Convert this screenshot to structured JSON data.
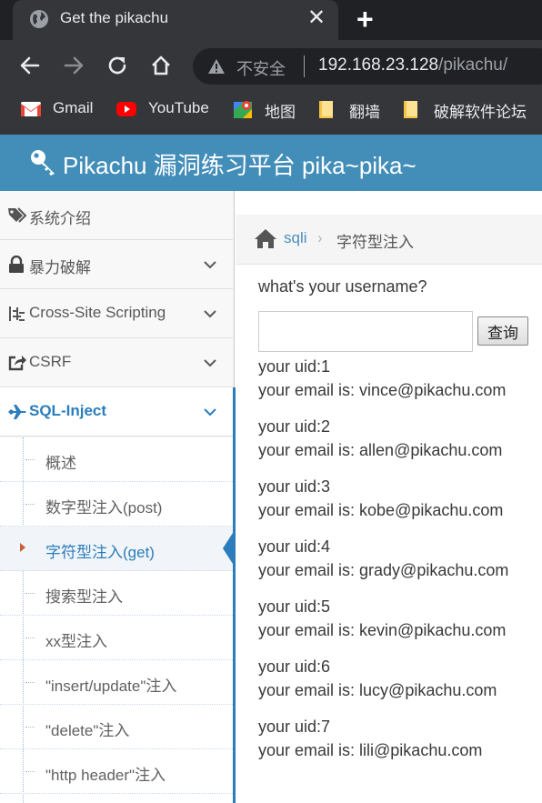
{
  "browser": {
    "tab_title": "Get the pikachu",
    "close_glyph": "✕",
    "newtab_glyph": "+",
    "insecure_label": "不安全",
    "url_host": "192.168.23.128",
    "url_path": "/pikachu/",
    "bookmarks": [
      {
        "label": "Gmail"
      },
      {
        "label": "YouTube"
      },
      {
        "label": "地图"
      },
      {
        "label": "翻墙"
      },
      {
        "label": "破解软件论坛"
      }
    ]
  },
  "header": {
    "title": "Pikachu 漏洞练习平台 pika~pika~"
  },
  "sidebar": {
    "items": [
      {
        "label": "系统介绍"
      },
      {
        "label": "暴力破解"
      },
      {
        "label": "Cross-Site Scripting"
      },
      {
        "label": "CSRF"
      },
      {
        "label": "SQL-Inject"
      }
    ],
    "sub_items": [
      {
        "label": "概述"
      },
      {
        "label": "数字型注入(post)"
      },
      {
        "label": "字符型注入(get)"
      },
      {
        "label": "搜索型注入"
      },
      {
        "label": "xx型注入"
      },
      {
        "label": "\"insert/update\"注入"
      },
      {
        "label": "\"delete\"注入"
      },
      {
        "label": "\"http header\"注入"
      }
    ]
  },
  "breadcrumb": {
    "parent": "sqli",
    "separator": "›",
    "current": "字符型注入"
  },
  "main": {
    "prompt": "what's your username?",
    "input_value": "",
    "submit_label": "查询",
    "results": [
      {
        "uid": "your uid:1",
        "email": "your email is: vince@pikachu.com"
      },
      {
        "uid": "your uid:2",
        "email": "your email is: allen@pikachu.com"
      },
      {
        "uid": "your uid:3",
        "email": "your email is: kobe@pikachu.com"
      },
      {
        "uid": "your uid:4",
        "email": "your email is: grady@pikachu.com"
      },
      {
        "uid": "your uid:5",
        "email": "your email is: kevin@pikachu.com"
      },
      {
        "uid": "your uid:6",
        "email": "your email is: lucy@pikachu.com"
      },
      {
        "uid": "your uid:7",
        "email": "your email is: lili@pikachu.com"
      }
    ]
  },
  "colors": {
    "header_blue": "#438eb9",
    "link_blue": "#2b7dbc",
    "chrome_dark": "#35363a"
  }
}
